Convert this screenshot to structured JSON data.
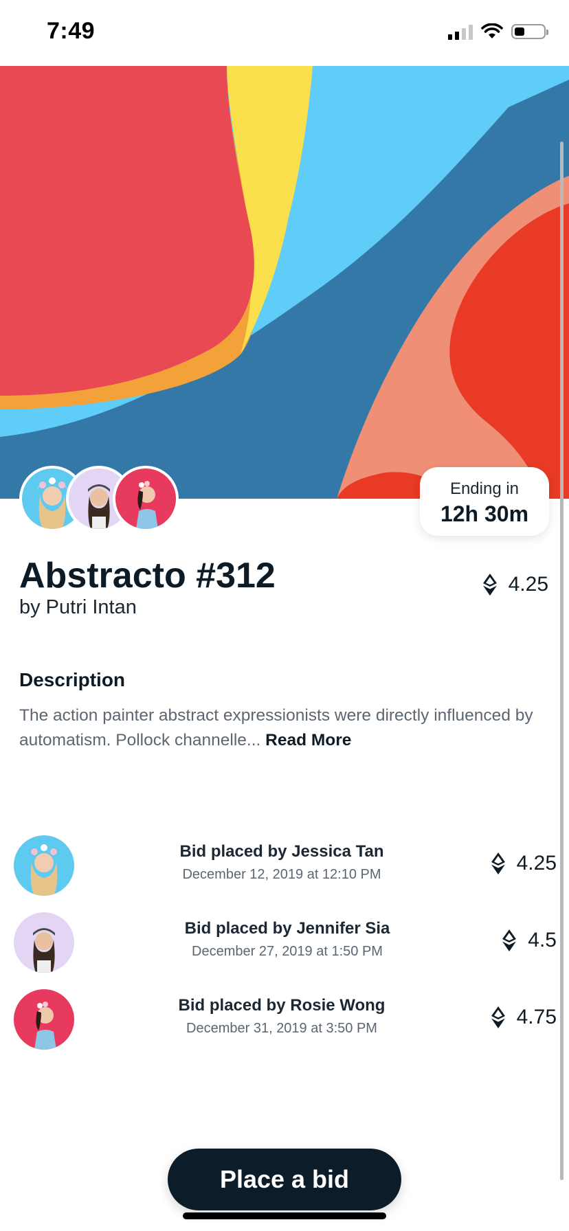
{
  "status_bar": {
    "time": "7:49"
  },
  "artwork": {
    "title": "Abstracto #312",
    "artist": "by Putri Intan",
    "price": "4.25",
    "ending_label": "Ending in",
    "ending_value": "12h 30m"
  },
  "description": {
    "heading": "Description",
    "text": "The action painter abstract expressionists were directly influenced by automatism. Pollock channelle...",
    "read_more": "Read More"
  },
  "bids": [
    {
      "name": "Bid placed by Jessica Tan",
      "date": "December 12, 2019 at 12:10 PM",
      "amount": "4.25",
      "avatar_color": "#5fcaf0"
    },
    {
      "name": "Bid placed by Jennifer Sia",
      "date": "December 27, 2019 at 1:50 PM",
      "amount": "4.5",
      "avatar_color": "#e3d6f5"
    },
    {
      "name": "Bid placed by Rosie Wong",
      "date": "December 31, 2019 at 3:50 PM",
      "amount": "4.75",
      "avatar_color": "#e83a5e"
    }
  ],
  "cta": {
    "label": "Place a bid"
  },
  "icons": {
    "currency": "ethereum-icon",
    "wifi": "wifi-icon",
    "battery": "battery-icon",
    "signal": "signal-icon"
  },
  "colors": {
    "primary_dark": "#0c1c28",
    "muted_text": "#5c6670",
    "hero_red": "#e84952",
    "hero_blue": "#3478a8",
    "hero_light_blue": "#5fcdf8",
    "hero_yellow": "#fbe04e",
    "hero_salmon": "#ef8f76"
  }
}
